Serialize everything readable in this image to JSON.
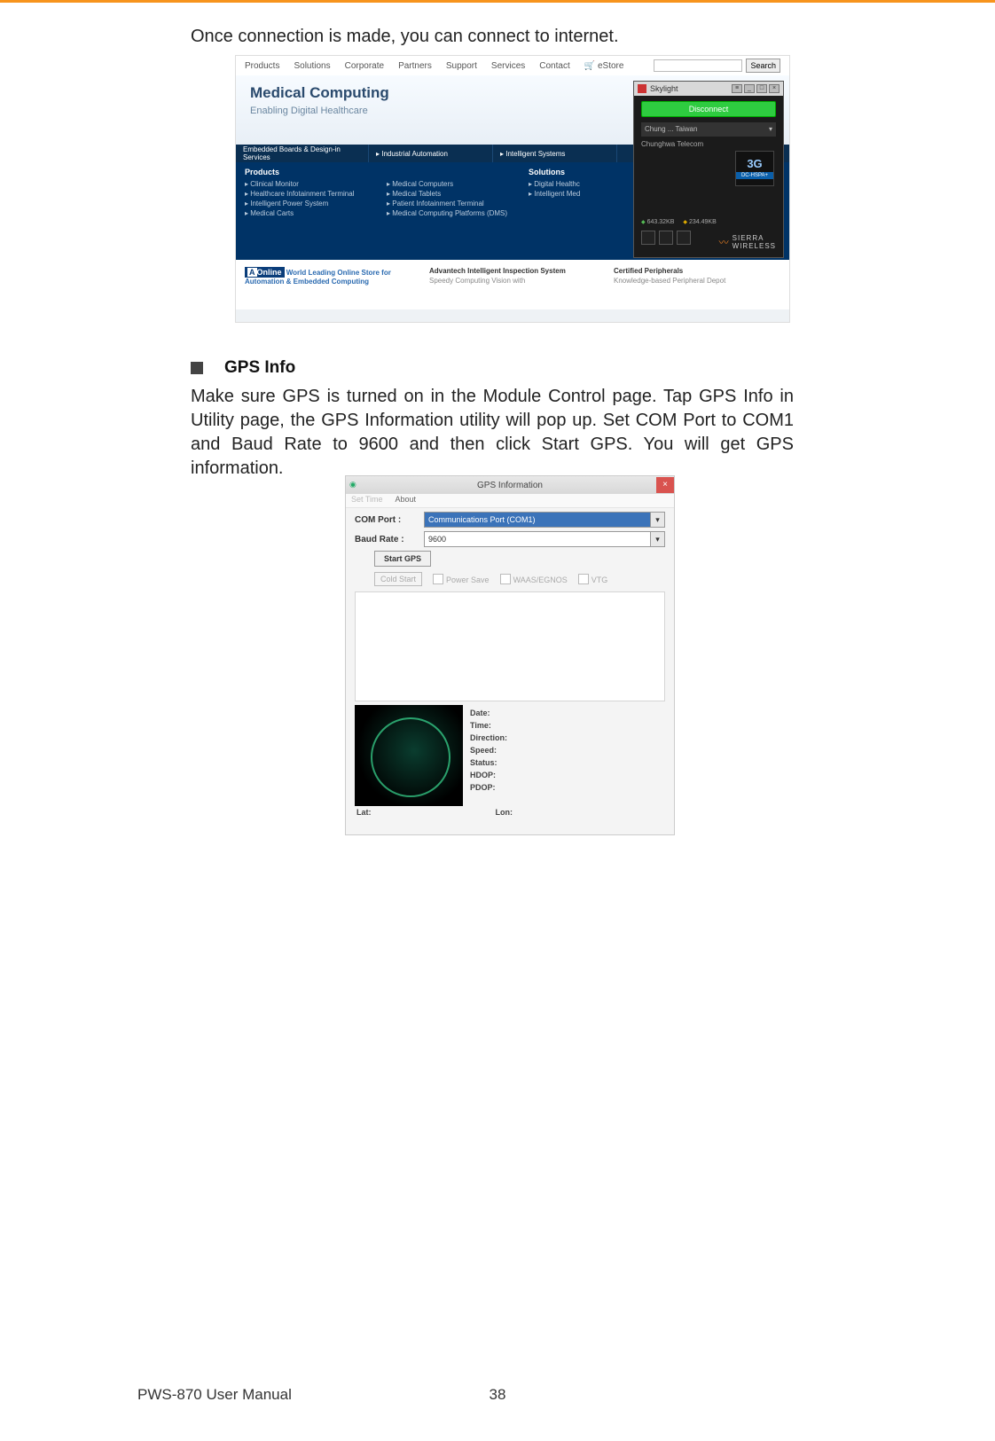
{
  "intro_text": "Once connection is made, you can connect to internet.",
  "shot1": {
    "nav": [
      "Products",
      "Solutions",
      "Corporate",
      "Partners",
      "Support",
      "Services",
      "Contact",
      "🛒 eStore"
    ],
    "search_button": "Search",
    "hero": {
      "title": "Medical Computing",
      "subtitle": "Enabling Digital Healthcare"
    },
    "tabs": [
      "Embedded Boards & Design-in Services",
      "▸ Industrial Automation",
      "▸ Intelligent Systems"
    ],
    "cols": [
      {
        "head": "Products",
        "items": [
          "▸ Clinical Monitor",
          "▸ Healthcare Infotainment Terminal",
          "▸ Intelligent Power System",
          "▸ Medical Carts"
        ]
      },
      {
        "head": "",
        "items": [
          "▸ Medical Computers",
          "▸ Medical Tablets",
          "▸ Patient Infotainment Terminal",
          "▸ Medical Computing Platforms (DMS)"
        ]
      },
      {
        "head": "Solutions",
        "items": [
          "▸ Digital Healthc",
          "▸ Intelligent Med"
        ]
      }
    ],
    "foot": [
      {
        "title": " World Leading Online Store for Automation & Embedded Computing"
      },
      {
        "title": "Advantech Intelligent Inspection System",
        "sub": "Speedy Computing Vision with"
      },
      {
        "title": "Certified Peripherals",
        "sub": "Knowledge-based Peripheral Depot"
      }
    ]
  },
  "skylight": {
    "title": "Skylight",
    "disconnect": "Disconnect",
    "location": "Chung ... Taiwan",
    "carrier": "Chunghwa Telecom",
    "network": "3G",
    "mode": "DC-HSPA+",
    "down": "643.32KB",
    "up": "234.49KB"
  },
  "section": {
    "title": "GPS Info",
    "body": "Make sure GPS is turned on in the Module Control page. Tap GPS Info in Utility page, the GPS Information utility will pop up. Set COM Port to COM1 and Baud Rate to 9600 and then click Start GPS. You will get GPS information."
  },
  "gps": {
    "window_title": "GPS Information",
    "menu": [
      "Set Time",
      "About"
    ],
    "com_port_label": "COM Port :",
    "com_port_value": "Communications Port (COM1)",
    "baud_label": "Baud Rate :",
    "baud_value": "9600",
    "start_button": "Start GPS",
    "cold_start": "Cold Start",
    "opt1": "Power Save",
    "opt2": "WAAS/EGNOS",
    "opt3": "VTG",
    "info": [
      "Date:",
      "Time:",
      "Direction:",
      "Speed:",
      "Status:",
      "HDOP:",
      "PDOP:"
    ],
    "lat_label": "Lat:",
    "lon_label": "Lon:"
  },
  "footer": {
    "manual": "PWS-870 User Manual",
    "page": "38"
  }
}
